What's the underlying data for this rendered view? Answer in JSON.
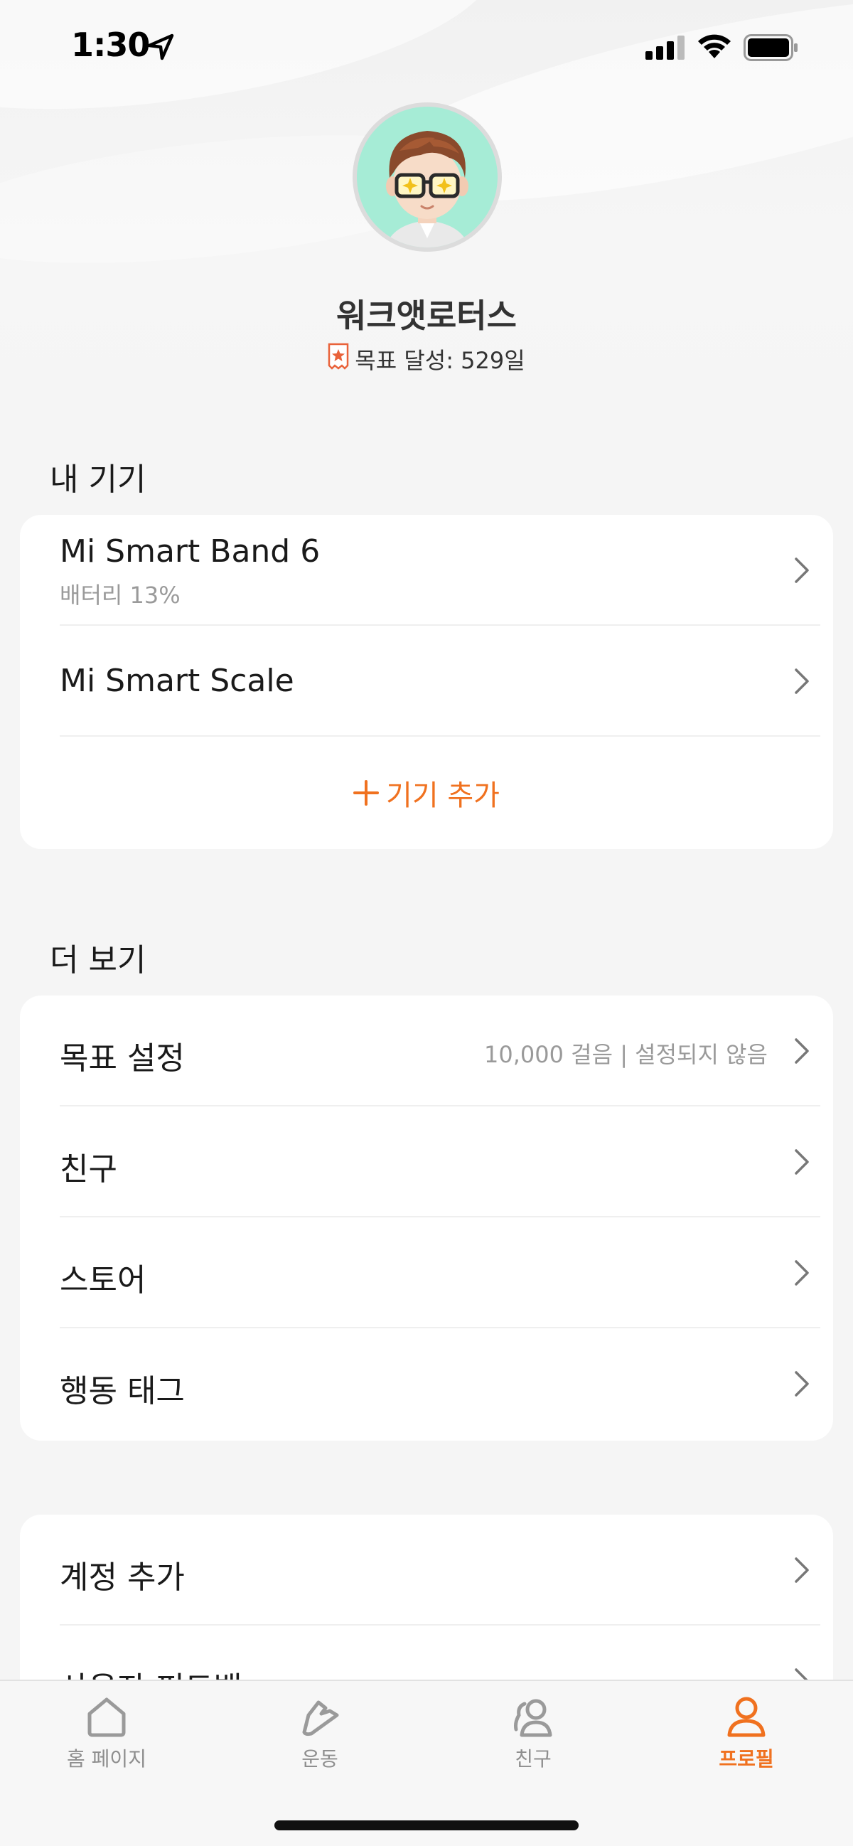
{
  "status_bar": {
    "time": "1:30",
    "icons": [
      "location-arrow-icon",
      "cell-signal-icon",
      "wifi-icon",
      "battery-icon"
    ]
  },
  "profile": {
    "username": "워크앳로터스",
    "goal_text": "목표 달성: 529일",
    "avatar": "avatar-glasses-character"
  },
  "devices_section": {
    "title": "내 기기",
    "items": [
      {
        "label": "Mi Smart Band 6",
        "sub": "배터리 13%"
      },
      {
        "label": "Mi Smart Scale"
      }
    ],
    "add_label": "기기 추가"
  },
  "more_section": {
    "title": "더 보기",
    "items": [
      {
        "label": "목표 설정",
        "value": "10,000 걸음 | 설정되지 않음"
      },
      {
        "label": "친구"
      },
      {
        "label": "스토어"
      },
      {
        "label": "행동 태그"
      }
    ]
  },
  "account_section": {
    "items": [
      {
        "label": "계정 추가"
      },
      {
        "label": "사용자 피드백"
      }
    ]
  },
  "bottom_nav": {
    "items": [
      {
        "label": "홈 페이지",
        "icon": "home-icon"
      },
      {
        "label": "운동",
        "icon": "shoe-icon"
      },
      {
        "label": "친구",
        "icon": "friends-icon"
      },
      {
        "label": "프로필",
        "icon": "profile-icon"
      }
    ],
    "active_index": 3
  },
  "colors": {
    "accent": "#f0711f",
    "background": "#f5f5f5",
    "card": "#ffffff",
    "secondary_text": "#9a9a9a",
    "avatar_bg": "#a6ecd6"
  }
}
